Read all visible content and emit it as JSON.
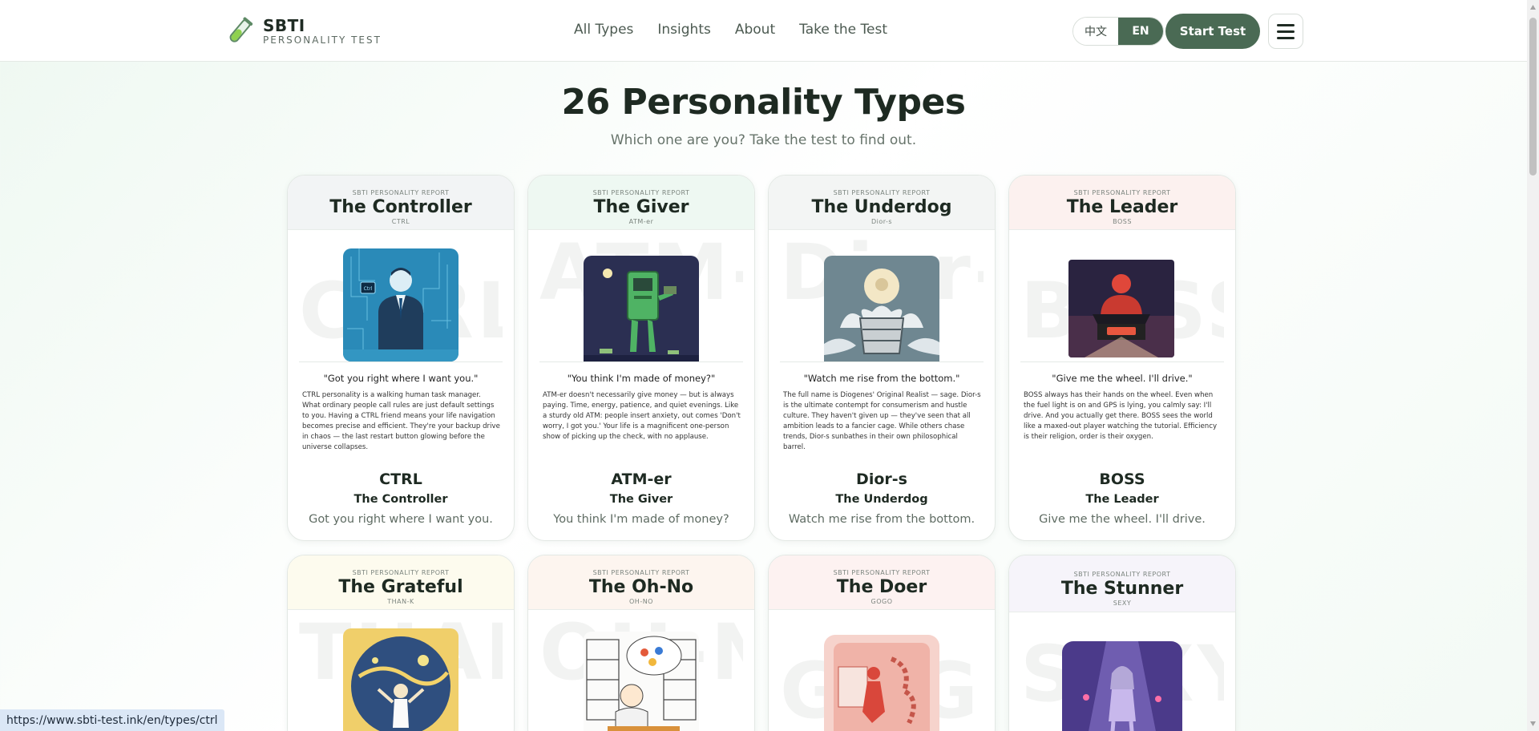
{
  "header": {
    "brand_title": "SBTI",
    "brand_sub": "PERSONALITY TEST",
    "nav": [
      "All Types",
      "Insights",
      "About",
      "Take the Test"
    ],
    "lang_zh": "中文",
    "lang_en": "EN",
    "start_label": "Start Test"
  },
  "hero": {
    "title": "26 Personality Types",
    "subtitle": "Which one are you? Take the test to find out."
  },
  "cards": [
    {
      "report": "SBTI PERSONALITY REPORT",
      "name": "The Controller",
      "code": "CTRL",
      "watermark": "CTRL",
      "quote": "\"Got you right where I want you.\"",
      "desc": "CTRL personality is a walking human task manager. What ordinary people call rules are just default settings to you. Having a CTRL friend means your life navigation becomes precise and efficient. They're your backup drive in chaos — the last restart button glowing before the universe collapses.",
      "title": "The Controller",
      "tagline": "Got you right where I want you.",
      "head_color": "#f2f4f5"
    },
    {
      "report": "SBTI PERSONALITY REPORT",
      "name": "The Giver",
      "code": "ATM-er",
      "watermark": "ATM-er",
      "quote": "\"You think I'm made of money?\"",
      "desc": "ATM-er doesn't necessarily give money — but is always paying. Time, energy, patience, and quiet evenings. Like a sturdy old ATM: people insert anxiety, out comes 'Don't worry, I got you.' Your life is a magnificent one-person show of picking up the check, with no applause.",
      "title": "The Giver",
      "tagline": "You think I'm made of money?",
      "head_color": "#eef8f2"
    },
    {
      "report": "SBTI PERSONALITY REPORT",
      "name": "The Underdog",
      "code": "Dior-s",
      "watermark": "Dior-s",
      "quote": "\"Watch me rise from the bottom.\"",
      "desc": "The full name is Diogenes' Original Realist — sage. Dior-s is the ultimate contempt for consumerism and hustle culture. They haven't given up — they've seen that all ambition leads to a fancier cage. While others chase trends, Dior-s sunbathes in their own philosophical barrel.",
      "title": "The Underdog",
      "tagline": "Watch me rise from the bottom.",
      "head_color": "#f3f5f4"
    },
    {
      "report": "SBTI PERSONALITY REPORT",
      "name": "The Leader",
      "code": "BOSS",
      "watermark": "BOSS",
      "quote": "\"Give me the wheel. I'll drive.\"",
      "desc": "BOSS always has their hands on the wheel. Even when the fuel light is on and GPS is lying, you calmly say: I'll drive. And you actually get there. BOSS sees the world like a maxed-out player watching the tutorial. Efficiency is their religion, order is their oxygen.",
      "title": "The Leader",
      "tagline": "Give me the wheel. I'll drive.",
      "head_color": "#fcf1ef"
    },
    {
      "report": "SBTI PERSONALITY REPORT",
      "name": "The Grateful",
      "code": "THAN-K",
      "watermark": "THAN-K",
      "head_color": "#fdfbee"
    },
    {
      "report": "SBTI PERSONALITY REPORT",
      "name": "The Oh-No",
      "code": "OH-NO",
      "watermark": "OH-NO",
      "head_color": "#fdf5ef"
    },
    {
      "report": "SBTI PERSONALITY REPORT",
      "name": "The Doer",
      "code": "GOGO",
      "watermark": "GOGO",
      "head_color": "#fdf2f1"
    },
    {
      "report": "SBTI PERSONALITY REPORT",
      "name": "The Stunner",
      "code": "SEXY",
      "watermark": "SEXY",
      "head_color": "#f6f4fa"
    }
  ],
  "status_url": "https://www.sbti-test.ink/en/types/ctrl",
  "icons": [
    "test-tube-logo-icon",
    "hamburger-menu-icon"
  ]
}
